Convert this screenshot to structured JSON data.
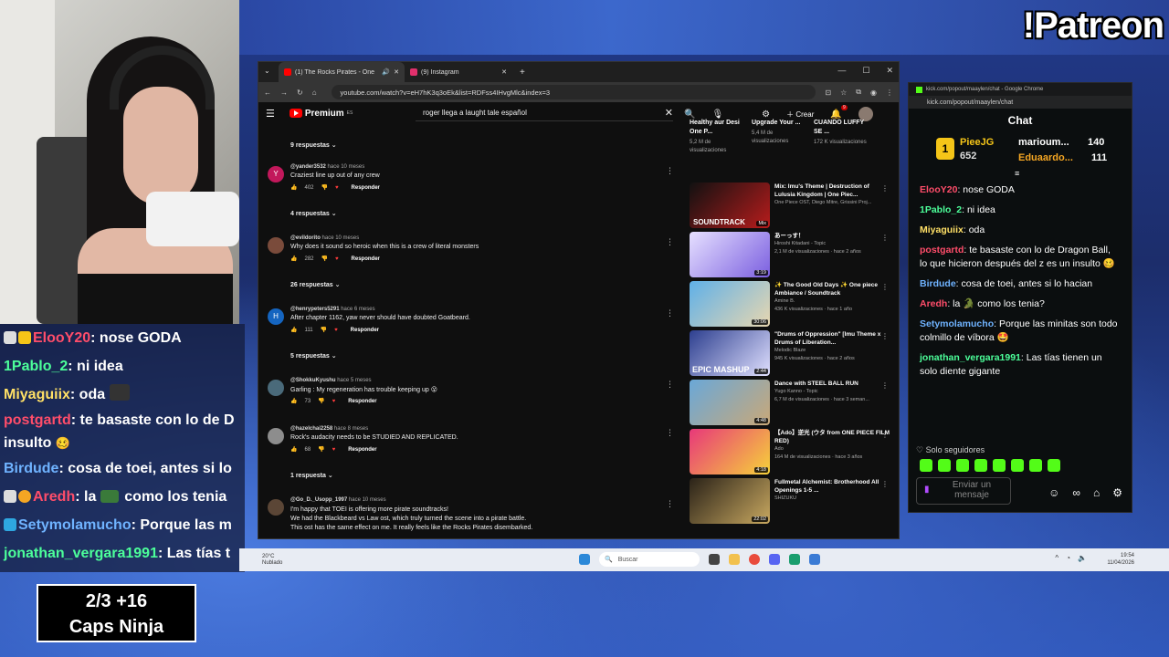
{
  "stream": {
    "patreon_label": "!Patreon",
    "caps_line1": "2/3  +16",
    "caps_line2": "Caps Ninja"
  },
  "overlay_chat": [
    {
      "user": "ElooY20",
      "color": "#ff4d6a",
      "msg": ": nose GODA"
    },
    {
      "user": "1Pablo_2",
      "color": "#4cff9a",
      "msg": ": ni idea"
    },
    {
      "user": "Miyaguiix",
      "color": "#ffe066",
      "msg": ": oda"
    },
    {
      "user": "postgartd",
      "color": "#ff4d6a",
      "msg": ": te basaste con lo de D"
    },
    {
      "user": "",
      "color": "#fff",
      "msg": "insulto"
    },
    {
      "user": "Birdude",
      "color": "#6fb3ff",
      "msg": ": cosa de toei, antes si lo"
    },
    {
      "user": "Aredh",
      "color": "#ff4d6a",
      "msg": ": la"
    },
    {
      "user": "Setymolamucho",
      "color": "#6fb3ff",
      "msg": ": Porque las m"
    },
    {
      "user": "jonathan_vergara1991",
      "color": "#4cff9a",
      "msg": ": Las tías t"
    }
  ],
  "overlay_chat_extra": {
    "como_los_tenia": "como los tenia"
  },
  "browser": {
    "tab1": "(1) The Rocks Pirates - One",
    "tab2": "(9) Instagram",
    "url": "youtube.com/watch?v=eH7hK3q3oEk&list=RDFss4IHvgMlc&index=3",
    "premium": "Premium",
    "premium_region": "ES",
    "search_query": "roger llega a laught tale español",
    "create": "Crear",
    "notif_count": "9"
  },
  "comments": {
    "replies_top": "9 respuestas",
    "items": [
      {
        "initial": "Y",
        "avcolor": "#c2185b",
        "user": "@yander3532",
        "when": "hace 10 meses",
        "text": "Craziest line up out of any crew",
        "likes": "402",
        "replies": "4 respuestas"
      },
      {
        "initial": "",
        "avcolor": "#7a4b3b",
        "user": "@evildorito",
        "when": "hace 10 meses",
        "text": "Why does it sound so heroic when this is a crew of literal monsters",
        "likes": "282",
        "replies": "26 respuestas"
      },
      {
        "initial": "H",
        "avcolor": "#1565c0",
        "user": "@henrypeters5291",
        "when": "hace 6 meses",
        "text": "After chapter 1162, yaw never should have doubted Goatbeard.",
        "likes": "111",
        "replies": "5 respuestas"
      },
      {
        "initial": "",
        "avcolor": "#4a6a7a",
        "user": "@ShokkuKyushu",
        "when": "hace 5 meses",
        "text": "Garling : My regeneration has trouble keeping up 😮",
        "likes": "73",
        "replies": ""
      },
      {
        "initial": "",
        "avcolor": "#8d8d8d",
        "user": "@hazelchai2258",
        "when": "hace 8 meses",
        "text": "Rock's audacity needs to be STUDIED AND REPLICATED.",
        "likes": "68",
        "replies": "1 respuesta"
      },
      {
        "initial": "",
        "avcolor": "#5b4636",
        "user": "@Go_D._Usopp_1997",
        "when": "hace 10 meses",
        "text": "I'm happy that TOEI is offering more pirate soundtracks!",
        "text2": "We had the Blackbeard vs Law ost, which truly turned the scene into a pirate battle.",
        "text3": "This ost has the same effect on me. It really feels like the Rocks Pirates disembarked.",
        "likes": "",
        "replies": ""
      }
    ],
    "reply_label": "Responder"
  },
  "shorts": [
    {
      "title": "Healthy aur Desi One P...",
      "views": "5,2 M de visualizaciones"
    },
    {
      "title": "Upgrade Your ...",
      "views": "5,4 M de visualizaciones"
    },
    {
      "title": "CUANDO LUFFY SE ...",
      "views": "172 K visualizaciones"
    }
  ],
  "related": [
    {
      "title": "Mix: Imu's Theme | Destruction of Lulusia Kingdom | One Piec...",
      "channel": "One Piece OST, Diego Mitre, Grissini Proj...",
      "dur": "Mix",
      "c1": "#1a1a1a",
      "c2": "#b71c1c",
      "overlay": "SOUNDTRACK"
    },
    {
      "title": "あーっす！",
      "channel": "Hiroshi Kitadani - Topic",
      "stats": "2,1 M de visualizaciones · hace 2 años",
      "dur": "3:19",
      "c1": "#e6e0ff",
      "c2": "#7b5fe0"
    },
    {
      "title": "✨ The Good Old Days ✨ One piece Ambiance / Soundtrack",
      "channel": "Amine B.",
      "stats": "436 K visualizaciones · hace 1 año",
      "dur": "30:06",
      "c1": "#5fb0e8",
      "c2": "#e8d7b0"
    },
    {
      "title": "\"Drums of Oppression\" [Imu Theme x Drums of Liberation...",
      "channel": "Melodic Blaze",
      "stats": "945 K visualizaciones · hace 2 años",
      "dur": "2:44",
      "c1": "#2d3f8f",
      "c2": "#e0e0ff",
      "overlay": "EPIC MASHUP"
    },
    {
      "title": "Dance with STEEL BALL RUN",
      "channel": "Yugo Kanno - Topic",
      "stats": "6,7 M de visualizaciones · hace 3 seman...",
      "dur": "4:48",
      "c1": "#6aa8d8",
      "c2": "#c9a878"
    },
    {
      "title": "【Ado】逆光 (ウタ from ONE PIECE FILM RED)",
      "channel": "Ado",
      "stats": "164 M de visualizaciones · hace 3 años",
      "dur": "4:18",
      "c1": "#e8387a",
      "c2": "#f6d23a"
    },
    {
      "title": "Fullmetal Alchemist: Brotherhood All Openings 1-5 ...",
      "channel": "SHIZUKU",
      "stats": "",
      "dur": "22:02",
      "c1": "#2a2218",
      "c2": "#c8a860"
    }
  ],
  "kick": {
    "window_title": "kick.com/popout/maaylen/chat - Google Chrome",
    "url": "kick.com/popout/maaylen/chat",
    "header": "Chat",
    "top1_user": "PieeJG",
    "top1_val": "652",
    "top2_user": "marioum...",
    "top2_val": "140",
    "top3_user": "Eduaardo...",
    "top3_val": "111",
    "lines": [
      {
        "user": "ElooY20",
        "color": "#ff4d6a",
        "msg": ": nose GODA"
      },
      {
        "user": "1Pablo_2",
        "color": "#4cff9a",
        "msg": ": ni idea"
      },
      {
        "user": "Miyaguiix",
        "color": "#ffe066",
        "msg": ": oda"
      },
      {
        "user": "postgartd",
        "color": "#ff4d6a",
        "msg": ": te basaste con lo de Dragon Ball, lo que hicieron después del z es un insulto 🥴"
      },
      {
        "user": "Birdude",
        "color": "#6fb3ff",
        "msg": ": cosa de toei, antes si lo hacian"
      },
      {
        "user": "Aredh",
        "color": "#ff4d6a",
        "msg": ": la 🐊 como los tenia?"
      },
      {
        "user": "Setymolamucho",
        "color": "#6fb3ff",
        "msg": ": Porque las minitas son todo colmillo de víbora 🤩"
      },
      {
        "user": "jonathan_vergara1991",
        "color": "#4cff9a",
        "msg": ": Las tías tienen un solo diente gigante"
      }
    ],
    "followers_only": "Solo seguidores",
    "input_placeholder": "Enviar un mensaje"
  },
  "taskbar": {
    "temp": "20°C",
    "weather": "Nublado",
    "search": "Buscar",
    "time": "19:54",
    "date": "11/04/2026"
  }
}
